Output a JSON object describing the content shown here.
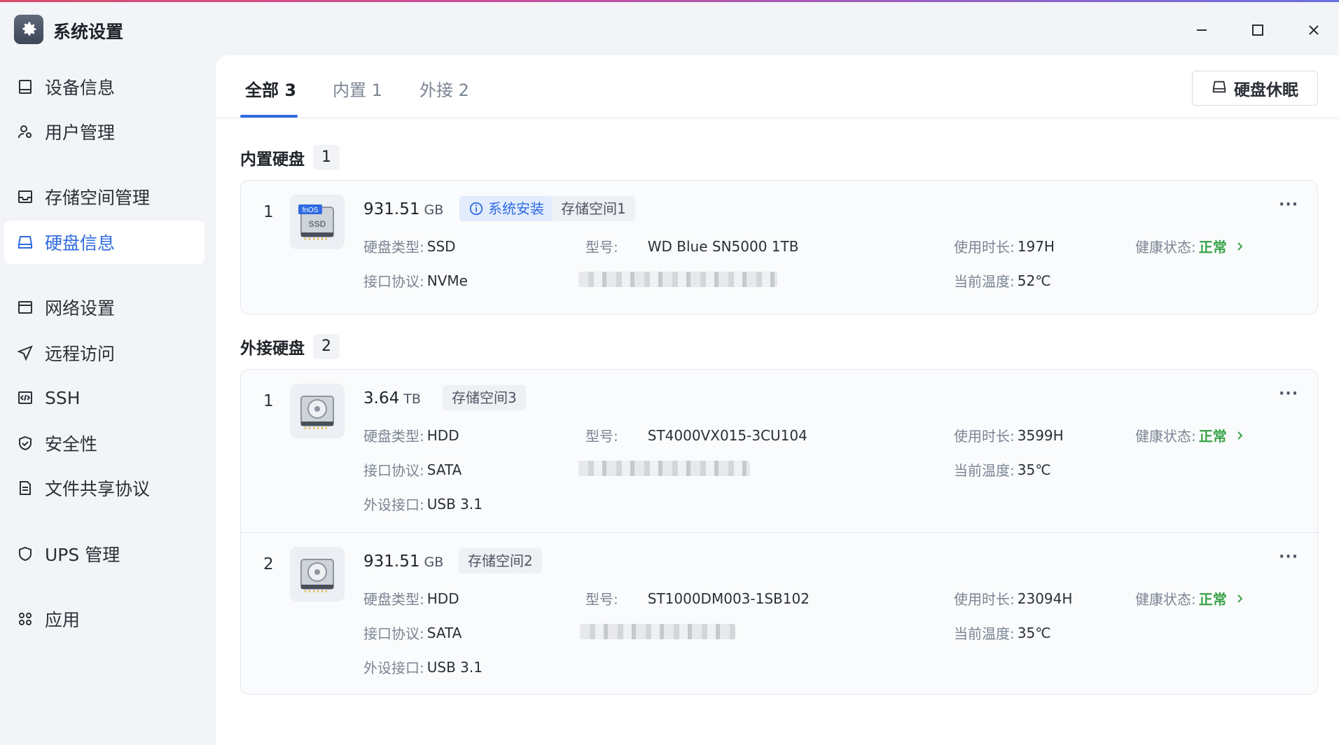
{
  "window": {
    "title": "系统设置"
  },
  "sidebar": {
    "items": [
      {
        "label": "设备信息",
        "icon": "device-icon"
      },
      {
        "label": "用户管理",
        "icon": "user-gear-icon"
      },
      {
        "label": "存储空间管理",
        "icon": "inbox-icon"
      },
      {
        "label": "硬盘信息",
        "icon": "disk-icon",
        "active": true
      },
      {
        "label": "网络设置",
        "icon": "network-card-icon"
      },
      {
        "label": "远程访问",
        "icon": "send-icon"
      },
      {
        "label": "SSH",
        "icon": "code-icon"
      },
      {
        "label": "安全性",
        "icon": "shield-check-icon"
      },
      {
        "label": "文件共享协议",
        "icon": "document-icon"
      },
      {
        "label": "UPS 管理",
        "icon": "shield-icon"
      },
      {
        "label": "应用",
        "icon": "apps-icon"
      }
    ]
  },
  "tabs": [
    {
      "label": "全部 3",
      "active": true
    },
    {
      "label": "内置 1"
    },
    {
      "label": "外接 2"
    }
  ],
  "sleep_button": {
    "label": "硬盘休眠"
  },
  "sections": {
    "internal": {
      "title": "内置硬盘",
      "count": "1",
      "disks": [
        {
          "index": "1",
          "capacity": "931.51",
          "unit": "GB",
          "badge_icon_text": "fnOS",
          "disk_icon_text": "SSD",
          "tags": {
            "system": "系统安装",
            "pool": "存储空间1"
          },
          "type_label": "硬盘类型:",
          "type": "SSD",
          "model_label": "型号:",
          "model": "WD Blue SN5000 1TB",
          "hours_label": "使用时长:",
          "hours": "197H",
          "health_label": "健康状态:",
          "health": "正常",
          "protocol_label": "接口协议:",
          "protocol": "NVMe",
          "temp_label": "当前温度:",
          "temp": "52℃"
        }
      ]
    },
    "external": {
      "title": "外接硬盘",
      "count": "2",
      "disks": [
        {
          "index": "1",
          "capacity": "3.64",
          "unit": "TB",
          "tags": {
            "pool": "存储空间3"
          },
          "type_label": "硬盘类型:",
          "type": "HDD",
          "model_label": "型号:",
          "model": "ST4000VX015-3CU104",
          "hours_label": "使用时长:",
          "hours": "3599H",
          "health_label": "健康状态:",
          "health": "正常",
          "protocol_label": "接口协议:",
          "protocol": "SATA",
          "temp_label": "当前温度:",
          "temp": "35℃",
          "port_label": "外设接口:",
          "port": "USB 3.1"
        },
        {
          "index": "2",
          "capacity": "931.51",
          "unit": "GB",
          "tags": {
            "pool": "存储空间2"
          },
          "type_label": "硬盘类型:",
          "type": "HDD",
          "model_label": "型号:",
          "model": "ST1000DM003-1SB102",
          "hours_label": "使用时长:",
          "hours": "23094H",
          "health_label": "健康状态:",
          "health": "正常",
          "protocol_label": "接口协议:",
          "protocol": "SATA",
          "temp_label": "当前温度:",
          "temp": "35℃",
          "port_label": "外设接口:",
          "port": "USB 3.1"
        }
      ]
    }
  },
  "more_glyph": "···",
  "colors": {
    "accent": "#2f6be0",
    "ok": "#3aa34a",
    "sidebar_bg": "#f2f4f7"
  }
}
